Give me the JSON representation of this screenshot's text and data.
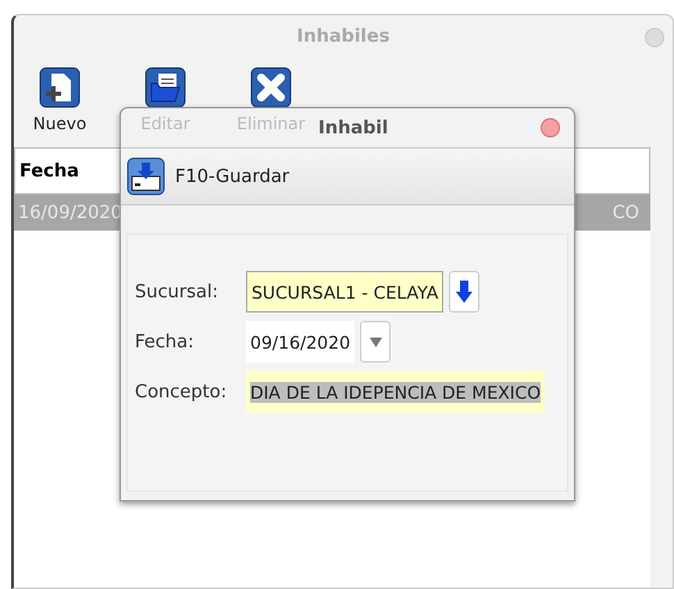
{
  "window": {
    "title": "Inhabiles"
  },
  "toolbar": [
    {
      "label": "Nuevo",
      "kind": "new",
      "disabled": false
    },
    {
      "label": "Editar",
      "kind": "edit",
      "disabled": true
    },
    {
      "label": "Eliminar",
      "kind": "delete",
      "disabled": true
    }
  ],
  "table": {
    "columns": [
      "Fecha"
    ],
    "rows": [
      {
        "cells": [
          "16/09/2020",
          "CO"
        ],
        "selected": true
      }
    ]
  },
  "dialog": {
    "title": "Inhabil",
    "save_button": "F10-Guardar",
    "fields": [
      {
        "label": "Sucursal:",
        "value": "SUCURSAL1 - CELAYA",
        "kind": "lookup",
        "text_selected": false
      },
      {
        "label": "Fecha:",
        "value": "09/16/2020",
        "kind": "date",
        "text_selected": false
      },
      {
        "label": "Concepto:",
        "value": "DIA DE LA IDEPENCIA DE MEXICO",
        "kind": "text",
        "text_selected": true
      }
    ]
  }
}
